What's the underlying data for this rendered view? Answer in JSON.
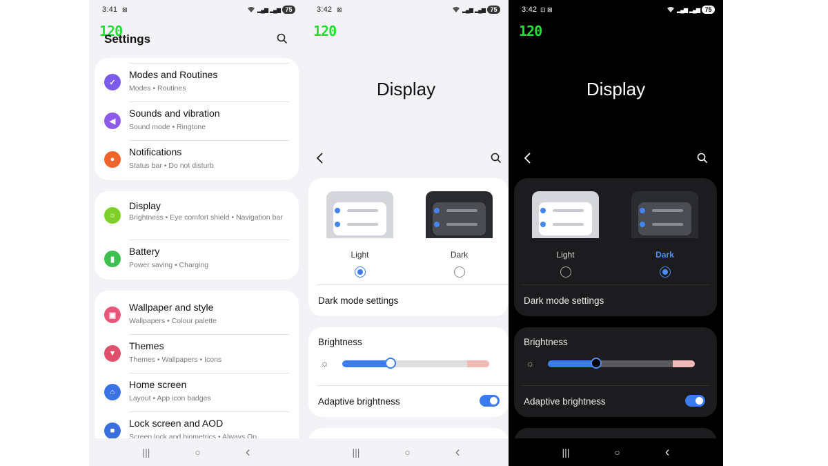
{
  "panel1": {
    "status": {
      "time": "3:41",
      "notif": "⊠",
      "battery": "75"
    },
    "fps": "120",
    "title": "Settings",
    "cards": [
      [
        {
          "title": "Modes and Routines",
          "subtitle": "Modes • Routines",
          "icon": "modes-icon",
          "color": "#7a5ce8"
        },
        {
          "title": "Sounds and vibration",
          "subtitle": "Sound mode • Ringtone",
          "icon": "sound-icon",
          "color": "#8c5ce8"
        },
        {
          "title": "Notifications",
          "subtitle": "Status bar • Do not disturb",
          "icon": "bell-icon",
          "color": "#f0642c"
        }
      ],
      [
        {
          "title": "Display",
          "subtitle": "Brightness • Eye comfort shield • Navigation bar",
          "icon": "sun-icon",
          "color": "#7fcf2a"
        },
        {
          "title": "Battery",
          "subtitle": "Power saving • Charging",
          "icon": "battery-icon",
          "color": "#3fbf4f"
        }
      ],
      [
        {
          "title": "Wallpaper and style",
          "subtitle": "Wallpapers • Colour palette",
          "icon": "wallpaper-icon",
          "color": "#e8577a"
        },
        {
          "title": "Themes",
          "subtitle": "Themes • Wallpapers • Icons",
          "icon": "themes-icon",
          "color": "#e0506d"
        },
        {
          "title": "Home screen",
          "subtitle": "Layout • App icon badges",
          "icon": "home-icon",
          "color": "#3b73e6"
        },
        {
          "title": "Lock screen and AOD",
          "subtitle": "Screen lock and biometrics • Always On",
          "icon": "lock-icon",
          "color": "#3b6fe0"
        }
      ]
    ]
  },
  "panel2": {
    "status": {
      "time": "3:42",
      "notif": "⊠",
      "battery": "75"
    },
    "fps": "120",
    "title": "Display",
    "light_label": "Light",
    "dark_label": "Dark",
    "selected": "light",
    "dark_mode_settings": "Dark mode settings",
    "brightness_label": "Brightness",
    "brightness_value": 0.33,
    "adaptive_label": "Adaptive brightness",
    "adaptive_on": true
  },
  "panel3": {
    "status": {
      "time": "3:42",
      "notif": "⊡ ⊠",
      "battery": "75"
    },
    "fps": "120",
    "title": "Display",
    "light_label": "Light",
    "dark_label": "Dark",
    "selected": "dark",
    "dark_mode_settings": "Dark mode settings",
    "brightness_label": "Brightness",
    "brightness_value": 0.33,
    "adaptive_label": "Adaptive brightness",
    "adaptive_on": true
  },
  "navbar": {
    "recents": "|||",
    "home": "○",
    "back": "‹"
  },
  "colors": {
    "accent": "#3a7bf0",
    "fps_green": "#22e033"
  }
}
